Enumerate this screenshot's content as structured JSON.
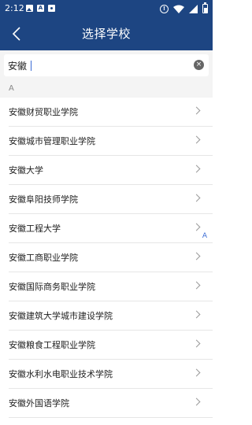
{
  "status_bar": {
    "time": "2:12",
    "a_badge": "A",
    "alert_symbol": "!"
  },
  "header": {
    "title": "选择学校"
  },
  "search": {
    "value": "安徽",
    "clear_symbol": "×"
  },
  "section": {
    "letter": "A"
  },
  "schools": [
    {
      "name": "安徽财贸职业学院"
    },
    {
      "name": "安徽城市管理职业学院"
    },
    {
      "name": "安徽大学"
    },
    {
      "name": "安徽阜阳技师学院"
    },
    {
      "name": "安徽工程大学"
    },
    {
      "name": "安徽工商职业学院"
    },
    {
      "name": "安徽国际商务职业学院"
    },
    {
      "name": "安徽建筑大学城市建设学院"
    },
    {
      "name": "安徽粮食工程职业学院"
    },
    {
      "name": "安徽水利水电职业技术学院"
    },
    {
      "name": "安徽外国语学院"
    }
  ],
  "index_bar": {
    "letter": "A"
  },
  "colors": {
    "header_bg": "#1d4582",
    "index_letter": "#3a6bd5"
  }
}
